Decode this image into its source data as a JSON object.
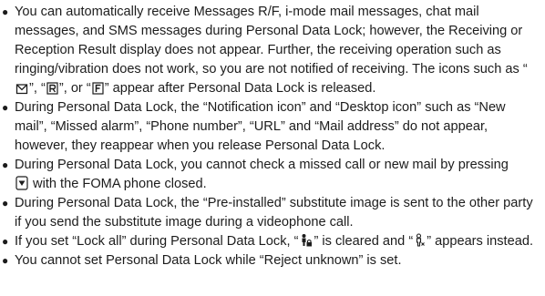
{
  "bullet_glyph": "●",
  "icons": {
    "mail_icon": "mail-envelope-icon",
    "r_icon": "r-reception-result-icon",
    "f_icon": "f-icon",
    "key_icon": "down-arrow-key-icon",
    "lock_icon": "lock-all-person-icon",
    "unlock_icon": "person-lock-cleared-icon"
  },
  "items": [
    {
      "p1": "You can automatically receive Messages R/F, i-mode mail messages, chat mail messages, and SMS messages during Personal Data Lock; however, the Receiving or Reception Result display does not appear. Further, the receiving operation such as ringing/vibration does not work, so you are not notified of receiving. The icons such as “",
      "p2": "”, “",
      "p3": "”, or “",
      "p4": "” appear after Personal Data Lock is released."
    },
    {
      "text": "During Personal Data Lock, the “Notification icon” and “Desktop icon” such as “New mail”, “Missed alarm”, “Phone number”, “URL” and “Mail address” do not appear, however, they reappear when you release Personal Data Lock."
    },
    {
      "p1": "During Personal Data Lock, you cannot check a missed call or new mail by pressing",
      "p2": " with the FOMA phone closed."
    },
    {
      "text": "During Personal Data Lock, the “Pre-installed” substitute image is sent to the other party if you send the substitute image during a videophone call."
    },
    {
      "p1": "If you set “Lock all” during Personal Data Lock, “",
      "p2": "” is cleared and “",
      "p3": "” appears instead."
    },
    {
      "text": "You cannot set Personal Data Lock while “Reject unknown” is set."
    }
  ]
}
